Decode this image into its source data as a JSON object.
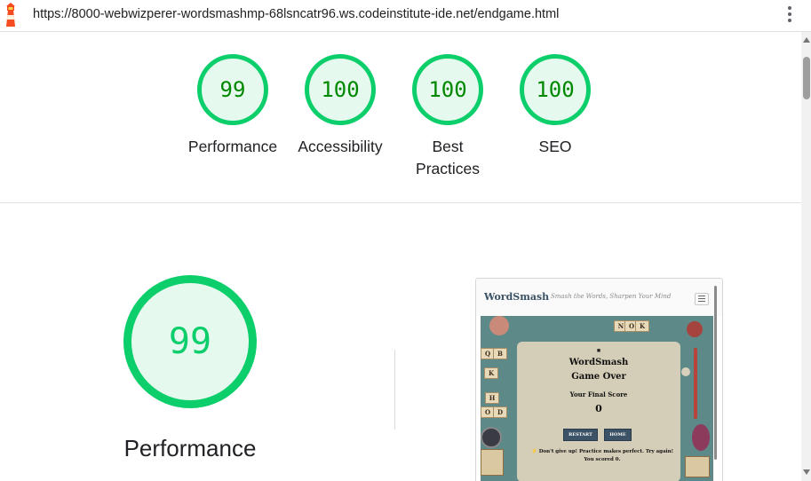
{
  "browser": {
    "url": "https://8000-webwizperer-wordsmashmp-68lsncatr96.ws.codeinstitute-ide.net/endgame.html",
    "app_icon": "lighthouse-icon",
    "menu_icon": "more-vert-icon"
  },
  "summary_scores": [
    {
      "score": "99",
      "label": "Performance"
    },
    {
      "score": "100",
      "label": "Accessibility"
    },
    {
      "score": "100",
      "label": "Best Practices"
    },
    {
      "score": "100",
      "label": "SEO"
    }
  ],
  "category": {
    "score": "99",
    "label": "Performance"
  },
  "preview": {
    "brand": "WordSmash",
    "tagline": "Smash the Words, Sharpen Your Mind",
    "tiles": [
      "N",
      "O",
      "K",
      "Q",
      "B",
      "K",
      "H",
      "O",
      "D"
    ],
    "card_mark": "■",
    "card_title": "WordSmash",
    "card_subtitle": "Game Over",
    "score_label": "Your Final Score",
    "score_value": "0",
    "restart_label": "RESTART",
    "home_label": "HOME",
    "message": "⚡ Don't give up! Practice makes perfect. Try again! You scored 0."
  },
  "colors": {
    "pass_green": "#0cce6b",
    "pass_fill": "#e5f9ee",
    "score_text_green": "#008800",
    "brand_blue": "#3c5266"
  }
}
